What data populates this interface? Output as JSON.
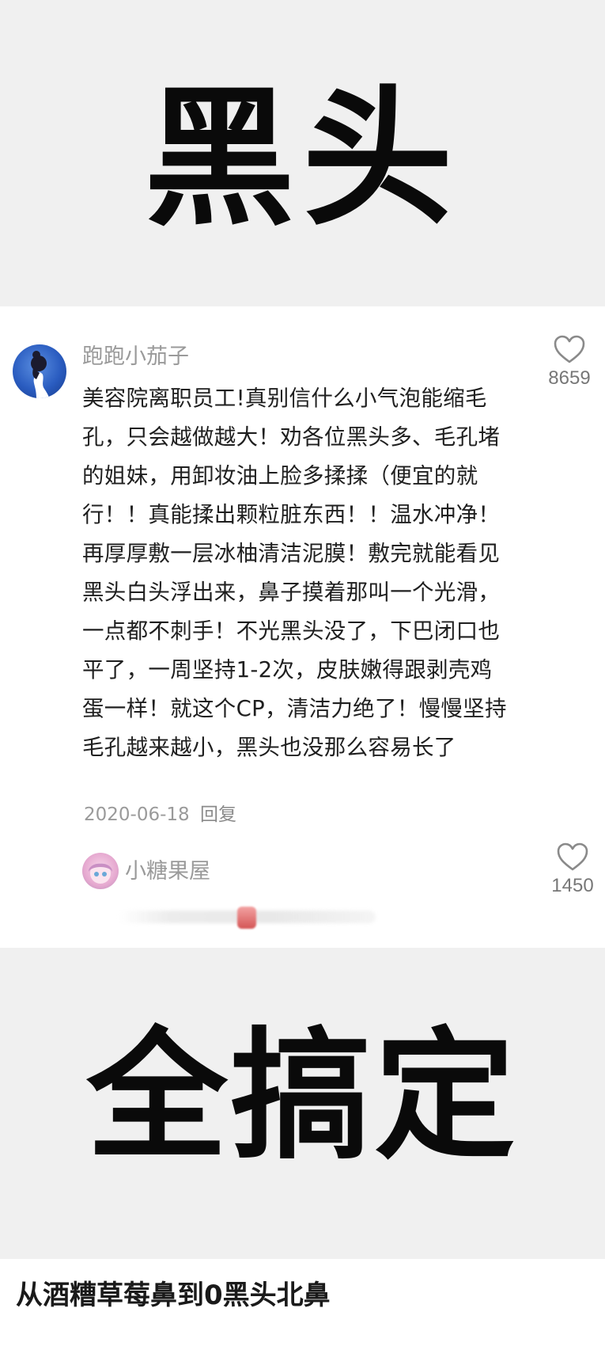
{
  "top_banner": {
    "title": "黑头"
  },
  "comments": [
    {
      "username": "跑跑小茄子",
      "text": "美容院离职员工!真别信什么小气泡能缩毛孔，只会越做越大！劝各位黑头多、毛孔堵的姐妹，用卸妆油上脸多揉揉（便宜的就行！！真能揉出颗粒脏东西！！温水冲净！再厚厚敷一层冰柚清洁泥膜！敷完就能看见黑头白头浮出来，鼻子摸着那叫一个光滑，一点都不刺手！不光黑头没了，下巴闭口也平了，一周坚持1-2次，皮肤嫩得跟剥壳鸡蛋一样！就这个CP，清洁力绝了！慢慢坚持毛孔越来越小，黑头也没那么容易长了",
      "date": "2020-06-18",
      "reply_label": "回复",
      "likes": "8659"
    },
    {
      "username": "小糖果屋",
      "likes": "1450"
    }
  ],
  "bottom_banner": {
    "title": "全搞定"
  },
  "caption": "从酒糟草莓鼻到0黑头北鼻",
  "icons": {
    "like": "heart-outline-icon",
    "avatar_1": "avatar-woman-icon",
    "avatar_2": "avatar-anime-girl-icon"
  },
  "colors": {
    "banner_bg": "#f0f0f0",
    "muted_text": "#9a9a9a",
    "body_text": "#1f1f1f"
  }
}
